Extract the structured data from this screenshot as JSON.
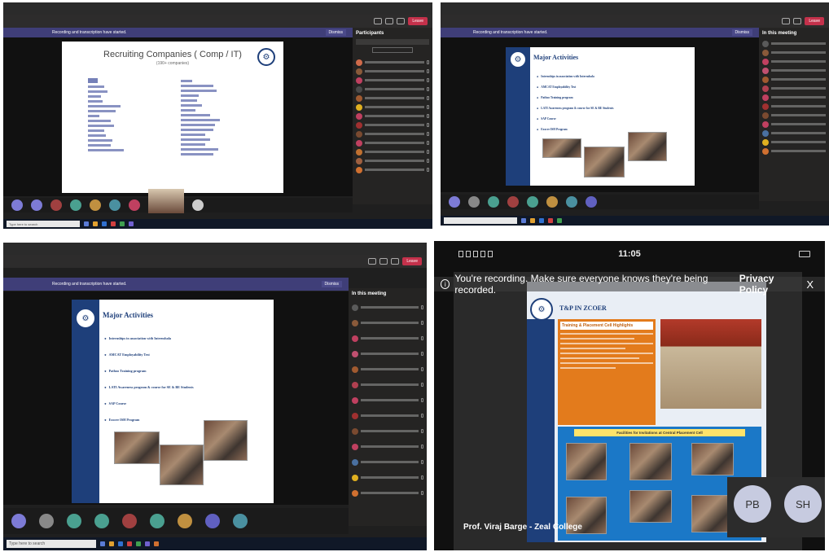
{
  "p1": {
    "notice_text": "Recording and transcription have started.",
    "dismiss": "Dismiss",
    "leave": "Leave",
    "side_title": "Participants",
    "slide_title": "Recruiting Companies ( Comp / IT)",
    "slide_sub": "(190+ companies)",
    "search": "Type here to search"
  },
  "p2": {
    "side_title": "In this meeting",
    "leave": "Leave",
    "notice_text": "Recording and transcription have started.",
    "dismiss": "Dismiss",
    "slide_title": "Major Activities",
    "items": [
      "Internships in association with Internshala",
      "AMCAT Employability Test",
      "Pathoo Training program",
      "LATI Awareness program & course for  SE & BE Students",
      "SAP Course",
      "Exocer ISH Program"
    ]
  },
  "p3": {
    "notice_text": "Recording and transcription have started.",
    "dismiss": "Dismiss",
    "leave": "Leave",
    "side_title": "In this meeting",
    "slide_title": "Major Activities",
    "items": [
      "Internships in association with Internshala",
      "AMCAT Employability Test",
      "Pathoo Training program",
      "LATI Awareness program & course for  SE & BE Students",
      "SAP Course",
      "Exocer ISH Program"
    ],
    "search": "Type here to search"
  },
  "p4": {
    "time": "11:05",
    "rec_text": "You're recording. Make sure everyone knows they're being recorded.",
    "privacy": "Privacy Policy",
    "close": "X",
    "tp_title": "T&P IN ZCOER",
    "highlights": "Training & Placement Cell Highlights",
    "facilities": "Facilities for Invitations at Central Placement Cell",
    "cam1": "PB",
    "cam2": "SH",
    "presenter": "Prof. Viraj Barge - Zeal College"
  }
}
